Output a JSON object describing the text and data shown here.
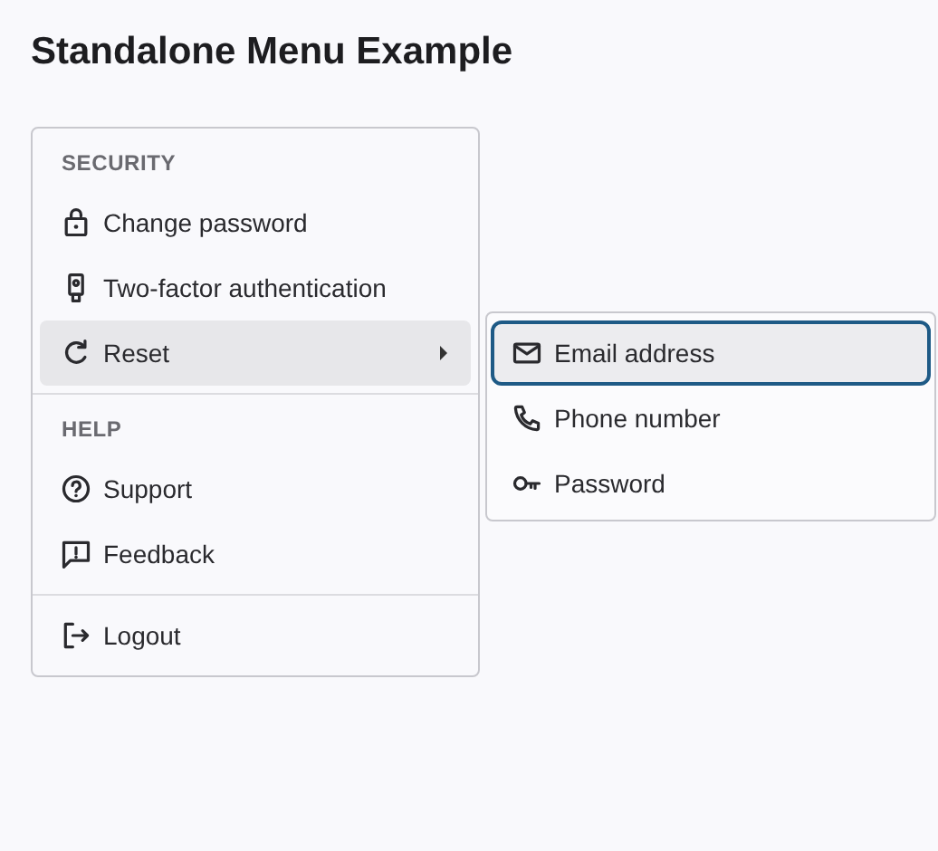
{
  "title": "Standalone Menu Example",
  "menu": {
    "sections": [
      {
        "header": "SECURITY",
        "items": [
          {
            "kind": "lock",
            "label": "Change password",
            "selected": false,
            "has_submenu": false
          },
          {
            "kind": "fob",
            "label": "Two-factor authentication",
            "selected": false,
            "has_submenu": false
          },
          {
            "kind": "refresh",
            "label": "Reset",
            "selected": true,
            "has_submenu": true
          }
        ]
      },
      {
        "header": "HELP",
        "items": [
          {
            "kind": "help",
            "label": "Support",
            "selected": false,
            "has_submenu": false
          },
          {
            "kind": "feedback",
            "label": "Feedback",
            "selected": false,
            "has_submenu": false
          }
        ]
      },
      {
        "items": [
          {
            "kind": "logout",
            "label": "Logout",
            "selected": false,
            "has_submenu": false
          }
        ]
      }
    ]
  },
  "submenu": {
    "items": [
      {
        "kind": "mail",
        "label": "Email address",
        "focused": true
      },
      {
        "kind": "phone",
        "label": "Phone number",
        "focused": false
      },
      {
        "kind": "key",
        "label": "Password",
        "focused": false
      }
    ]
  }
}
